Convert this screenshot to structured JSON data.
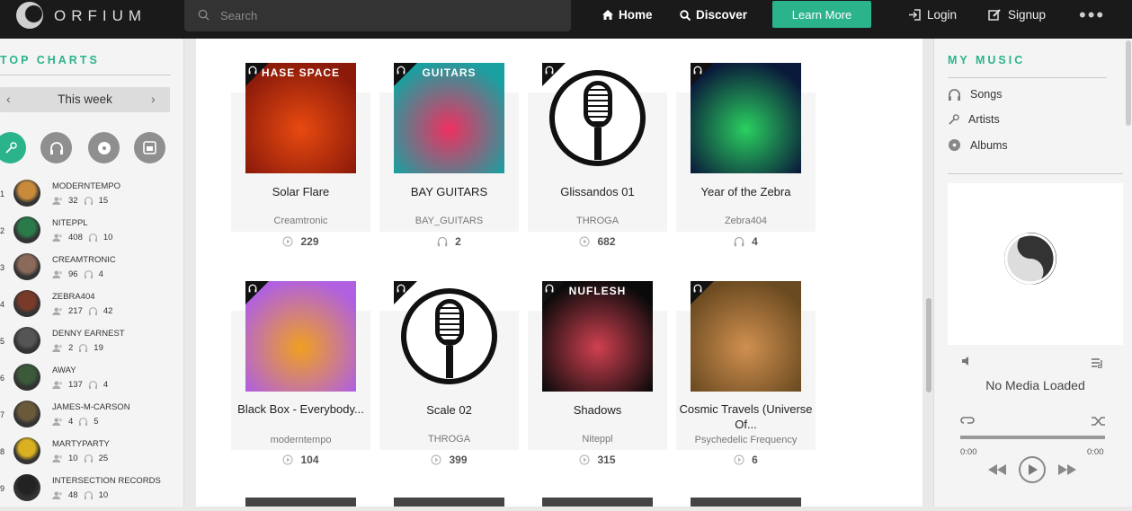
{
  "header": {
    "logo_text": "ORFIUM",
    "search_placeholder": "Search",
    "nav_home": "Home",
    "nav_discover": "Discover",
    "learn_more": "Learn More",
    "login": "Login",
    "signup": "Signup",
    "more": "•••"
  },
  "sidebar": {
    "title": "TOP CHARTS",
    "period": "This week",
    "charts": [
      {
        "rank": "1",
        "name": "MODERNTEMPO",
        "followers": "32",
        "listens": "15",
        "color": "#c98a3a"
      },
      {
        "rank": "2",
        "name": "NITEPPL",
        "followers": "408",
        "listens": "10",
        "color": "#2a7a4a"
      },
      {
        "rank": "3",
        "name": "CREAMTRONIC",
        "followers": "96",
        "listens": "4",
        "color": "#8a6a5a"
      },
      {
        "rank": "4",
        "name": "ZEBRA404",
        "followers": "217",
        "listens": "42",
        "color": "#7a3a2a"
      },
      {
        "rank": "5",
        "name": "DENNY EARNEST",
        "followers": "2",
        "listens": "19",
        "color": "#555"
      },
      {
        "rank": "6",
        "name": "AWAY",
        "followers": "137",
        "listens": "4",
        "color": "#3a5a3a"
      },
      {
        "rank": "7",
        "name": "JAMES-M-CARSON",
        "followers": "4",
        "listens": "5",
        "color": "#6a5a3a"
      },
      {
        "rank": "8",
        "name": "MARTYPARTY",
        "followers": "10",
        "listens": "25",
        "color": "#d8b020"
      },
      {
        "rank": "9",
        "name": "INTERSECTION RECORDS",
        "followers": "48",
        "listens": "10",
        "color": "#222"
      }
    ]
  },
  "tracks": [
    {
      "title": "Solar Flare",
      "artist": "Creamtronic",
      "plays": "229",
      "cover_text": "HASE SPACE",
      "colors": [
        "#8b1a0a",
        "#e84a10"
      ],
      "play_icon": "play"
    },
    {
      "title": "BAY GUITARS",
      "artist": "BAY_GUITARS",
      "plays": "2",
      "cover_text": "GUITARS",
      "colors": [
        "#1aa0a0",
        "#f03060"
      ],
      "play_icon": "headphones"
    },
    {
      "title": "Glissandos 01",
      "artist": "THROGA",
      "plays": "682",
      "cover_text": "",
      "colors": [
        "#ffffff",
        "#111111"
      ],
      "play_icon": "play"
    },
    {
      "title": "Year of the Zebra",
      "artist": "Zebra404",
      "plays": "4",
      "cover_text": "",
      "colors": [
        "#0a1a3a",
        "#2ad060"
      ],
      "play_icon": "headphones"
    },
    {
      "title": "Black Box - Everybody...",
      "artist": "moderntempo",
      "plays": "104",
      "cover_text": "",
      "colors": [
        "#b060e0",
        "#f0a020"
      ],
      "play_icon": "play"
    },
    {
      "title": "Scale 02",
      "artist": "THROGA",
      "plays": "399",
      "cover_text": "",
      "colors": [
        "#ffffff",
        "#111111"
      ],
      "play_icon": "play"
    },
    {
      "title": "Shadows",
      "artist": "Niteppl",
      "plays": "315",
      "cover_text": "NUFLESH",
      "colors": [
        "#0a0a0a",
        "#d04050"
      ],
      "play_icon": "play"
    },
    {
      "title": "Cosmic Travels (Universe Of...",
      "artist": "Psychedelic Frequency",
      "plays": "6",
      "cover_text": "",
      "colors": [
        "#6a4a20",
        "#d09050"
      ],
      "play_icon": "play"
    }
  ],
  "my_music": {
    "title": "MY MUSIC",
    "items": [
      "Songs",
      "Artists",
      "Albums"
    ]
  },
  "player": {
    "status": "No Media Loaded",
    "time_current": "0:00",
    "time_total": "0:00"
  },
  "accent": "#2bb38b"
}
